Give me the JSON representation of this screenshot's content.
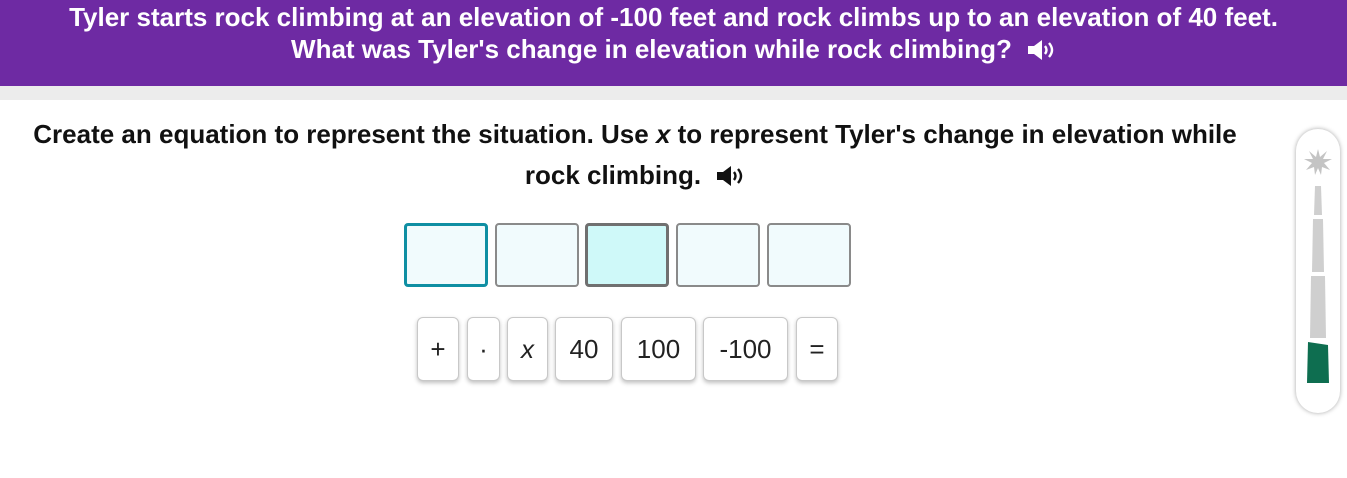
{
  "question": {
    "line1": "Tyler starts rock climbing at an elevation of -100 feet and rock climbs up to an elevation of 40 feet.",
    "line2": "What was Tyler's change in elevation while rock climbing?",
    "audio_icon": "speaker-icon"
  },
  "prompt": {
    "part1": "Create an equation to represent the situation. Use ",
    "variable": "x",
    "part2": " to represent Tyler's change in elevation while",
    "part3": "rock climbing.",
    "audio_icon": "speaker-icon"
  },
  "answer_slots": {
    "count": 5,
    "active_index": 0,
    "highlighted_index": 2
  },
  "tiles": [
    "+",
    "·",
    "x",
    "40",
    "100",
    "-100",
    "="
  ],
  "progress_meter": {
    "icon": "starburst-icon",
    "segments": 4,
    "filled_segments": 1,
    "fill_color": "#0e6e50",
    "empty_color": "#cfcfcf"
  },
  "colors": {
    "banner": "#6e2aa3",
    "active_slot_border": "#0f8fa3",
    "highlight_slot": "#cff9f9"
  }
}
